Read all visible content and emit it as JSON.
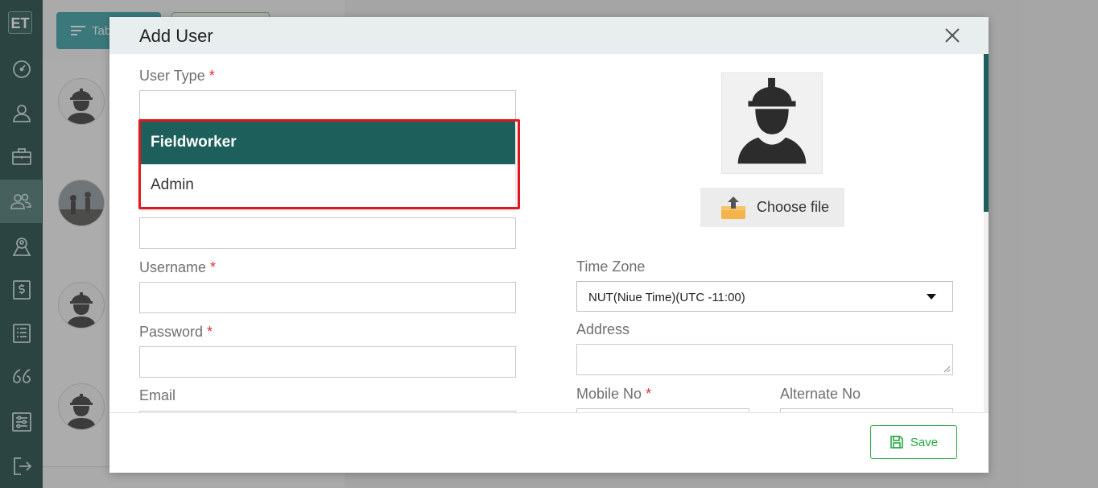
{
  "sidebar": {
    "logo": "ET",
    "items": [
      {
        "icon": "dashboard-gauge-icon"
      },
      {
        "icon": "user-icon"
      },
      {
        "icon": "briefcase-icon"
      },
      {
        "icon": "users-icon",
        "active": true
      },
      {
        "icon": "location-user-icon"
      },
      {
        "icon": "dollar-icon"
      },
      {
        "icon": "list-icon"
      },
      {
        "icon": "quote-icon"
      },
      {
        "icon": "sliders-icon"
      },
      {
        "icon": "logout-icon"
      }
    ]
  },
  "background": {
    "tab_button_label": "Tab"
  },
  "modal": {
    "title": "Add User",
    "fields": {
      "user_type_label": "User Type",
      "username_label": "Username",
      "password_label": "Password",
      "email_label": "Email",
      "time_zone_label": "Time Zone",
      "time_zone_value": "NUT(Niue Time)(UTC -11:00)",
      "address_label": "Address",
      "mobile_no_label": "Mobile No",
      "alternate_no_label": "Alternate No",
      "required_mark": "*"
    },
    "user_type_options": [
      {
        "label": "Fieldworker",
        "selected": true
      },
      {
        "label": "Admin",
        "selected": false
      }
    ],
    "choose_file_label": "Choose file",
    "save_label": "Save"
  },
  "colors": {
    "sidebar_bg": "#0d3b37",
    "selected_option": "#1d5f5a",
    "highlight_border": "#e0191f",
    "save_green": "#28a745",
    "required_red": "#e03131"
  }
}
